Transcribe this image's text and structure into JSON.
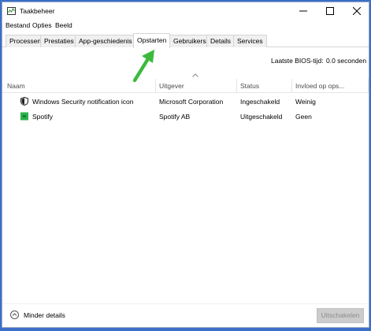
{
  "window": {
    "title": "Taakbeheer",
    "controls": [
      "minimize-icon",
      "maximize-icon",
      "close-icon"
    ]
  },
  "menu": [
    "Bestand",
    "Opties",
    "Beeld"
  ],
  "tabs": [
    {
      "label": "Processen",
      "active": false
    },
    {
      "label": "Prestaties",
      "active": false
    },
    {
      "label": "App-geschiedenis",
      "active": false
    },
    {
      "label": "Opstarten",
      "active": true
    },
    {
      "label": "Gebruikers",
      "active": false
    },
    {
      "label": "Details",
      "active": false
    },
    {
      "label": "Services",
      "active": false
    }
  ],
  "bios": {
    "label": "Laatste BIOS-tijd:",
    "value": "0.0 seconden"
  },
  "table": {
    "columns": [
      "Naam",
      "Uitgever",
      "Status",
      "Invloed op ops..."
    ],
    "rows": [
      {
        "icon": "shield-icon",
        "name": "Windows Security notification icon",
        "publisher": "Microsoft Corporation",
        "status": "Ingeschakeld",
        "impact": "Weinig"
      },
      {
        "icon": "spotify-icon",
        "name": "Spotify",
        "publisher": "Spotify AB",
        "status": "Uitgeschakeld",
        "impact": "Geen"
      }
    ]
  },
  "footer": {
    "fewer_details": "Minder details",
    "disable_button": "Uitschakelen"
  },
  "colors": {
    "accent_arrow": "#3cba3c",
    "desktop": "#3b6fc9",
    "spotify_icon": "#2bb24c"
  }
}
